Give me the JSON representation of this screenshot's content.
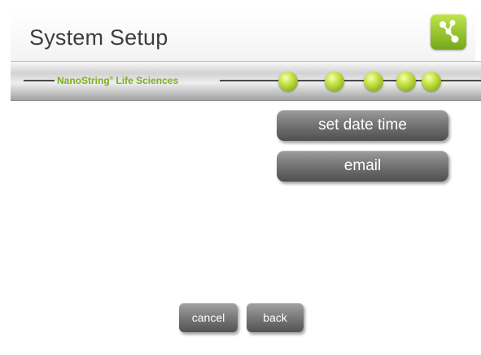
{
  "header": {
    "title": "System Setup",
    "logo_icon": "network-nodes-icon"
  },
  "banner": {
    "brand_name": "NanoString",
    "brand_mark": "®",
    "brand_suffix": " Life Sciences",
    "progress_dots": 5
  },
  "menu": {
    "items": [
      {
        "label": "set date time"
      },
      {
        "label": "email"
      }
    ]
  },
  "footer": {
    "cancel_label": "cancel",
    "back_label": "back"
  },
  "colors": {
    "brand_green": "#7eae1f",
    "button_gray": "#6e6e6e",
    "title_text": "#3d3d3d"
  }
}
